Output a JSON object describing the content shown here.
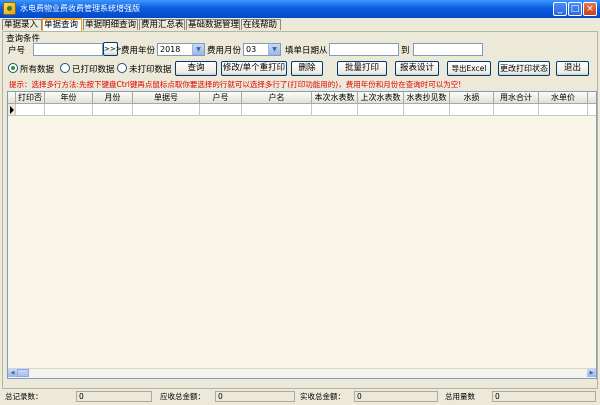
{
  "window": {
    "title": "水电费物业费收费管理系统增强版",
    "icon": "app-icon",
    "buttons": [
      "_",
      "□",
      "×"
    ]
  },
  "tabs": [
    {
      "label": "单据录入",
      "active": false
    },
    {
      "label": "单据查询",
      "active": true
    },
    {
      "label": "单据明细查询",
      "active": false
    },
    {
      "label": "费用汇总表",
      "active": false
    },
    {
      "label": "基础数据管理",
      "active": false
    },
    {
      "label": "在线帮助",
      "active": false
    }
  ],
  "query": {
    "group_title": "查询条件",
    "account_label": "户号",
    "account_value": "",
    "lookup_button": ">>>",
    "year_label": "费用年份",
    "year_value": "2018",
    "month_label": "费用月份",
    "month_value": "03",
    "date_from_label": "填单日期从",
    "date_from_value": "",
    "date_to_label": "到",
    "date_to_value": ""
  },
  "filters": [
    {
      "label": "所有数据",
      "checked": true
    },
    {
      "label": "已打印数据",
      "checked": false
    },
    {
      "label": "未打印数据",
      "checked": false
    }
  ],
  "actions": {
    "query": "查询",
    "modify": "修改/单个重打印",
    "delete": "删除",
    "batch_print": "批量打印",
    "report_design": "报表设计",
    "export_excel": "导出Excel",
    "change_print_status": "更改打印状态",
    "exit": "退出"
  },
  "hint": "提示：选择多行方法:先按下键盘Ctrl键再点鼠标点取你要选择的行就可以选择多行了(打印功能用的)，费用年份和月份在查询时可以为空!",
  "table": {
    "columns": [
      "打印否",
      "年份",
      "月份",
      "单据号",
      "户号",
      "户名",
      "本次水表数",
      "上次水表数",
      "水表抄见数",
      "水损",
      "用水合计",
      "水单价",
      ""
    ],
    "rows": []
  },
  "status": {
    "total_records_label": "总记录数：",
    "total_records": "0",
    "receivable_label": "应收总金额：",
    "receivable": "0",
    "received_label": "实收总金额：",
    "received": "0",
    "total_usage_label": "总用量数",
    "total_usage": "0"
  }
}
